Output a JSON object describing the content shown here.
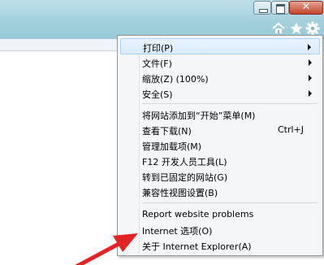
{
  "menu": {
    "group1": [
      {
        "label": "打印(P)",
        "submenu": true
      },
      {
        "label": "文件(F)",
        "submenu": true
      },
      {
        "label": "缩放(Z) (100%)",
        "submenu": true
      },
      {
        "label": "安全(S)",
        "submenu": true
      }
    ],
    "group2": [
      {
        "label": "将网站添加到“开始”菜单(M)"
      },
      {
        "label": "查看下载(N)",
        "shortcut": "Ctrl+J"
      },
      {
        "label": "管理加载项(M)"
      },
      {
        "label": "F12 开发人员工具(L)"
      },
      {
        "label": "转到已固定的网站(G)"
      },
      {
        "label": "兼容性视图设置(B)"
      }
    ],
    "group3": [
      {
        "label": "Report website problems"
      },
      {
        "label": "Internet 选项(O)"
      },
      {
        "label": "关于 Internet Explorer(A)"
      }
    ]
  },
  "colors": {
    "annotation_arrow": "#e32424",
    "highlight": "#d9ebfd",
    "titlebar": "#a9d3df"
  }
}
